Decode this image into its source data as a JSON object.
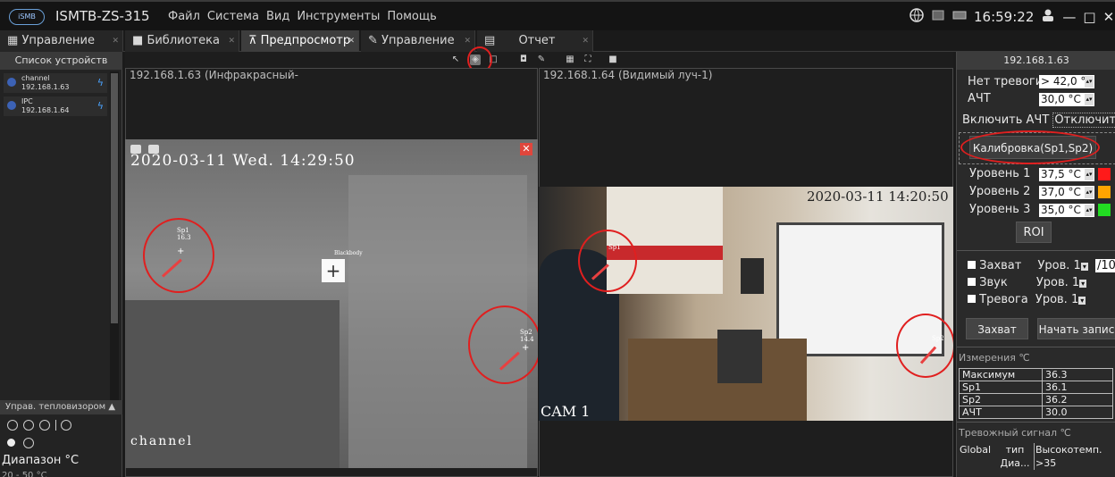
{
  "titlebar": {
    "logo_text": "iSMB",
    "app_title": "ISMTB-ZS-315",
    "menu": [
      "Файл",
      "Система",
      "Вид",
      "Инструменты",
      "Помощь"
    ],
    "clock": "16:59:22",
    "min_glyph": "—",
    "max_glyph": "□",
    "close_glyph": "✕"
  },
  "tabs": [
    {
      "label": "Управление",
      "icon": "grid-icon"
    },
    {
      "label": "Библиотека",
      "icon": "library-icon"
    },
    {
      "label": "Предпросмотр",
      "icon": "preview-icon",
      "active": true
    },
    {
      "label": "Управление",
      "icon": "wrench-icon"
    },
    {
      "label": "Отчет",
      "icon": "report-icon"
    }
  ],
  "left_panel": {
    "header": "Список устройств",
    "devices": [
      {
        "name": "channel",
        "ip": "192.168.1.63"
      },
      {
        "name": "IPC",
        "ip": "192.168.1.64"
      }
    ],
    "thermal_control_label": "Управ. тепловизором ▲",
    "range_label": "Диапазон °C",
    "range_value": "20 - 50 °C"
  },
  "panes": {
    "left": {
      "title": "192.168.1.63 (Инфракрасный-",
      "timestamp": "2020-03-11 Wed. 14:29:50",
      "channel_name": "channel",
      "sp1_label": "Sp1",
      "sp1_value": "16.3",
      "sp2_label": "Sp2",
      "sp2_value": "14.4",
      "blackbody_label": "Blackbody"
    },
    "right": {
      "title": "192.168.1.64 (Видимый луч-1)",
      "timestamp": "2020-03-11 14:20:50",
      "cam_label": "CAM 1",
      "sp1_label": "Sp1",
      "sp2_label": "Sp2"
    }
  },
  "right_panel": {
    "header": "192.168.1.63",
    "no_alarm_label": "Нет тревоги",
    "no_alarm_value": "> 42,0 °C",
    "ahch_label": "АЧТ",
    "ahch_value": "30,0 °C",
    "enable_btn": "Включить АЧТ",
    "disable_btn": "Отключить А",
    "calibrate_btn": "Калибровка(Sp1,Sp2)",
    "levels": [
      {
        "label": "Уровень 1",
        "value": "37,5 °C",
        "color": "#ff1a1a"
      },
      {
        "label": "Уровень 2",
        "value": "37,0 °C",
        "color": "#ffa500"
      },
      {
        "label": "Уровень 3",
        "value": "35,0 °C",
        "color": "#22dd22"
      }
    ],
    "roi_btn": "ROI",
    "checks": [
      {
        "label": "Захват",
        "select": "Уров. 1",
        "extra": "/10"
      },
      {
        "label": "Звук",
        "select": "Уров. 1"
      },
      {
        "label": "Тревога",
        "select": "Уров. 1"
      }
    ],
    "capture_btn": "Захват",
    "record_btn": "Начать запис",
    "measurements_label": "Измерения ℃",
    "measurements": [
      {
        "k": "Максимум",
        "v": "36.3"
      },
      {
        "k": "Sp1",
        "v": "36.1"
      },
      {
        "k": "Sp2",
        "v": "36.2"
      },
      {
        "k": "АЧТ",
        "v": "30.0"
      }
    ],
    "alarm_signal_label": "Тревожный сигнал ℃",
    "alarm_cols": [
      "Global",
      "тип",
      "Высокотемп."
    ],
    "alarm_row": [
      "",
      "Диа...",
      ">35"
    ]
  }
}
